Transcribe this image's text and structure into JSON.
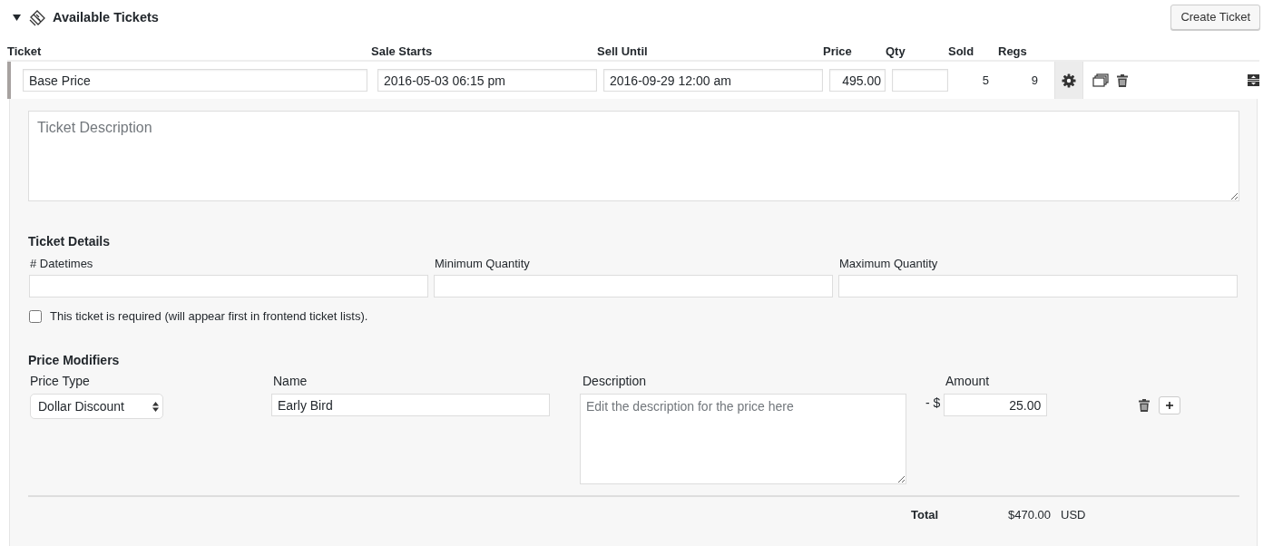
{
  "section": {
    "title": "Available Tickets",
    "expanded": true,
    "create_button": "Create Ticket"
  },
  "columns": [
    "Ticket",
    "Sale Starts",
    "Sell Until",
    "Price",
    "Qty",
    "Sold",
    "Regs"
  ],
  "ticket": {
    "name": "Base Price",
    "sale_starts": "2016-05-03 06:15 pm",
    "sell_until": "2016-09-29 12:00 am",
    "price": "495.00",
    "sold": "5",
    "regs": "9",
    "settings_open": true
  },
  "panel": {
    "description_placeholder": "Ticket Description",
    "details_title": "Ticket Details",
    "detail_fields": [
      {
        "label": "# Datetimes"
      },
      {
        "label": "Minimum Quantity"
      },
      {
        "label": "Maximum Quantity"
      }
    ],
    "required_checkbox": {
      "label": "This ticket is required (will appear first in frontend ticket lists).",
      "checked": false
    },
    "modifiers_title": "Price Modifiers",
    "modifier_columns": [
      "Price Type",
      "Name",
      "Description",
      "Amount"
    ],
    "modifiers": [
      {
        "type": "Dollar Discount",
        "name": "Early Bird",
        "description_placeholder": "Edit the description for the price here",
        "sign": "- $",
        "amount": "25.00"
      }
    ],
    "total_label": "Total",
    "total_value": "$470.00",
    "currency": "USD"
  }
}
